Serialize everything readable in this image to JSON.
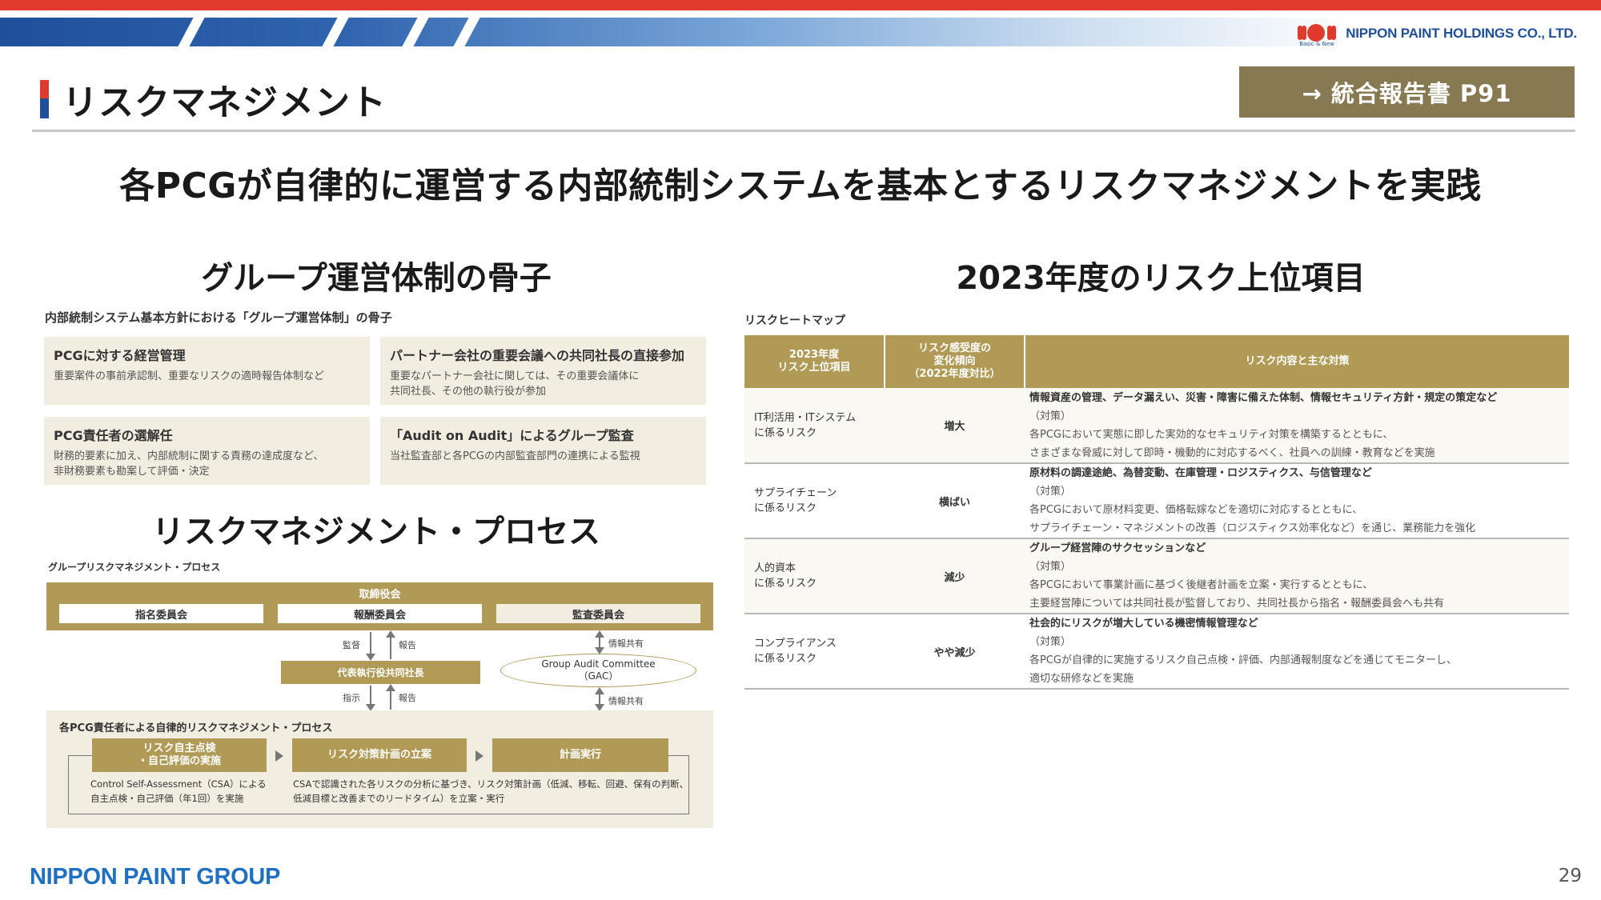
{
  "header": {
    "company_logo_text": "NIPPON PAINT HOLDINGS CO., LTD.",
    "logo_tagline": "Basic & New",
    "page_title": "リスクマネジメント",
    "ref_button_label": "→ 統合報告書 P91",
    "headline": "各PCGが自律的に運営する内部統制システムを基本とするリスクマネジメントを実践"
  },
  "governance": {
    "heading": "グループ運営体制の骨子",
    "caption": "内部統制システム基本方針における「グループ運営体制」の骨子",
    "cards": [
      {
        "title": "PCGに対する経営管理",
        "line1": "重要案件の事前承認制、重要なリスクの適時報告体制など",
        "line2": ""
      },
      {
        "title": "パートナー会社の重要会議への共同社長の直接参加",
        "line1": "重要なパートナー会社に関しては、その重要会議体に",
        "line2": "共同社長、その他の執行役が参加"
      },
      {
        "title": "PCG責任者の選解任",
        "line1": "財務的要素に加え、内部統制に関する責務の達成度など、",
        "line2": "非財務要素も勘案して評価・決定"
      },
      {
        "title": "「Audit on Audit」によるグループ監査",
        "line1": "当社監査部と各PCGの内部監査部門の連携による監視",
        "line2": ""
      }
    ]
  },
  "process": {
    "heading": "リスクマネジメント・プロセス",
    "caption": "グループリスクマネジメント・プロセス",
    "board_label": "取締役会",
    "committees": [
      "指名委員会",
      "報酬委員会",
      "監査委員会"
    ],
    "arrow_labels": {
      "supervise": "監督",
      "report_up": "報告",
      "info_share_top": "情報共有",
      "instruct": "指示",
      "report_low": "報告",
      "info_share_bottom": "情報共有"
    },
    "ceo_box": "代表執行役共同社長",
    "gac_line1": "Group Audit Committee",
    "gac_line2": "（GAC）",
    "pcg_label": "各PCG責任者による自律的リスクマネジメント・プロセス",
    "steps": [
      {
        "line1": "リスク自主点検",
        "line2": "・自己評価の実施"
      },
      {
        "line1": "リスク対策計画の立案",
        "line2": ""
      },
      {
        "line1": "計画実行",
        "line2": ""
      }
    ],
    "desc1_line1": "Control Self-Assessment（CSA）による",
    "desc1_line2": "自主点検・自己評価（年1回）を実施",
    "desc2_line1": "CSAで認識された各リスクの分析に基づき、リスク対策計画（低減、移転、回避、保有の判断、",
    "desc2_line2": "低減目標と改善までのリードタイム）を立案・実行"
  },
  "risk": {
    "heading": "2023年度のリスク上位項目",
    "caption": "リスクヒートマップ",
    "headers": {
      "col1_line1": "2023年度",
      "col1_line2": "リスク上位項目",
      "col2_line1": "リスク感受度の",
      "col2_line2": "変化傾向",
      "col2_line3": "（2022年度対比）",
      "col3": "リスク内容と主な対策"
    },
    "rows": [
      {
        "item1": "IT利活用・ITシステム",
        "item2": "に係るリスク",
        "trend": "増大",
        "title": "情報資産の管理、データ漏えい、災害・障害に備えた体制、情報セキュリティ方針・規定の策定など",
        "l1": "（対策）",
        "l2": "各PCGにおいて実態に即した実効的なセキュリティ対策を構築するとともに、",
        "l3": "さまざまな脅威に対して即時・機動的に対応するべく、社員への訓練・教育などを実施"
      },
      {
        "item1": "サプライチェーン",
        "item2": "に係るリスク",
        "trend": "横ばい",
        "title": "原材料の調達途絶、為替変動、在庫管理・ロジスティクス、与信管理など",
        "l1": "（対策）",
        "l2": "各PCGにおいて原材料変更、価格転嫁などを適切に対応するとともに、",
        "l3": "サプライチェーン・マネジメントの改善（ロジスティクス効率化など）を通じ、業務能力を強化"
      },
      {
        "item1": "人的資本",
        "item2": "に係るリスク",
        "trend": "減少",
        "title": "グループ経営陣のサクセッションなど",
        "l1": "（対策）",
        "l2": "各PCGにおいて事業計画に基づく後継者計画を立案・実行するとともに、",
        "l3": "主要経営陣については共同社長が監督しており、共同社長から指名・報酬委員会へも共有"
      },
      {
        "item1": "コンプライアンス",
        "item2": "に係るリスク",
        "trend": "やや減少",
        "title": "社会的にリスクが増大している機密情報管理など",
        "l1": "（対策）",
        "l2": "各PCGが自律的に実施するリスク自己点検・評価、内部通報制度などを通じてモニターし、",
        "l3": "適切な研修などを実施"
      }
    ]
  },
  "footer": {
    "group_logo": "NIPPON PAINT GROUP",
    "page_number": "29"
  },
  "colors": {
    "accent_red": "#e03a2c",
    "brand_blue": "#1f4f9a",
    "gold": "#b09a55",
    "ref_button": "#877a52",
    "card_bg": "#f1ede0"
  }
}
